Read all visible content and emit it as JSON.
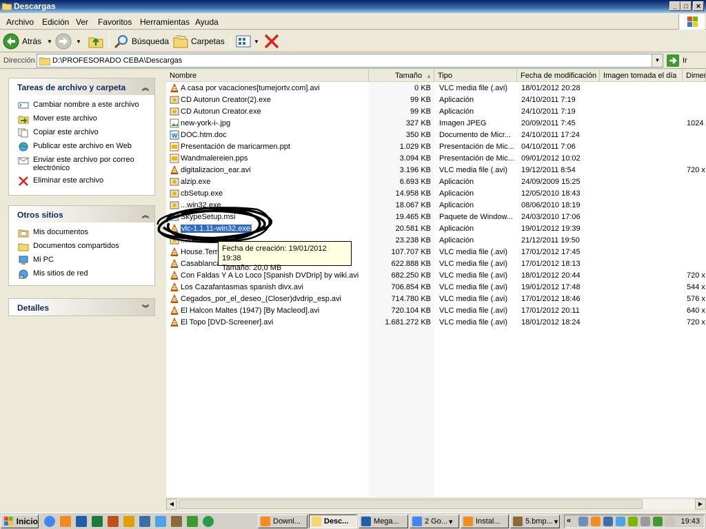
{
  "window": {
    "title": "Descargas"
  },
  "menu": [
    "Archivo",
    "Edición",
    "Ver",
    "Favoritos",
    "Herramientas",
    "Ayuda"
  ],
  "toolbar": {
    "back": "Atrás",
    "search": "Búsqueda",
    "folders": "Carpetas"
  },
  "address": {
    "label": "Dirección",
    "value": "D:\\PROFESORADO CEBA\\Descargas",
    "go": "Ir"
  },
  "tasks_panel": {
    "title": "Tareas de archivo y carpeta",
    "items": [
      {
        "label": "Cambiar nombre a este archivo",
        "icon": "rename-icon"
      },
      {
        "label": "Mover este archivo",
        "icon": "move-icon"
      },
      {
        "label": "Copiar este archivo",
        "icon": "copy-icon"
      },
      {
        "label": "Publicar este archivo en Web",
        "icon": "publish-web-icon"
      },
      {
        "label": "Enviar este archivo por correo electrónico",
        "icon": "email-icon"
      },
      {
        "label": "Eliminar este archivo",
        "icon": "delete-icon"
      }
    ]
  },
  "places_panel": {
    "title": "Otros sitios",
    "items": [
      {
        "label": "Mis documentos",
        "icon": "my-documents-icon"
      },
      {
        "label": "Documentos compartidos",
        "icon": "shared-documents-icon"
      },
      {
        "label": "Mi PC",
        "icon": "my-computer-icon"
      },
      {
        "label": "Mis sitios de red",
        "icon": "network-places-icon"
      }
    ]
  },
  "details_panel": {
    "title": "Detalles"
  },
  "columns": {
    "name": "Nombre",
    "size": "Tamaño",
    "type": "Tipo",
    "modified": "Fecha de modificación",
    "taken": "Imagen tomada el día",
    "dim": "Dimen"
  },
  "files": [
    {
      "name": "A casa por vacaciones[tumejortv.com].avi",
      "size": "0 KB",
      "type": "VLC media file (.avi)",
      "date": "18/01/2012 20:28",
      "dim": "",
      "icon": "vlc"
    },
    {
      "name": "CD Autorun Creator(2).exe",
      "size": "99 KB",
      "type": "Aplicación",
      "date": "24/10/2011 7:19",
      "dim": "",
      "icon": "app"
    },
    {
      "name": "CD Autorun Creator.exe",
      "size": "99 KB",
      "type": "Aplicación",
      "date": "24/10/2011 7:19",
      "dim": "",
      "icon": "app"
    },
    {
      "name": "new-york-i-.jpg",
      "size": "327 KB",
      "type": "Imagen JPEG",
      "date": "20/09/2011 7:45",
      "dim": "1024",
      "icon": "img"
    },
    {
      "name": "DOC.htm.doc",
      "size": "350 KB",
      "type": "Documento de Micr...",
      "date": "24/10/2011 17:24",
      "dim": "",
      "icon": "doc"
    },
    {
      "name": "Presentación de maricarmen.ppt",
      "size": "1.029 KB",
      "type": "Presentación de Mic...",
      "date": "04/10/2011 7:06",
      "dim": "",
      "icon": "ppt"
    },
    {
      "name": "Wandmalereien.pps",
      "size": "3.094 KB",
      "type": "Presentación de Mic...",
      "date": "09/01/2012 10:02",
      "dim": "",
      "icon": "ppt"
    },
    {
      "name": "digitalizacion_ear.avi",
      "size": "3.196 KB",
      "type": "VLC media file (.avi)",
      "date": "19/12/2011 8:54",
      "dim": "720 x",
      "icon": "vlc"
    },
    {
      "name": "alzip.exe",
      "size": "6.693 KB",
      "type": "Aplicación",
      "date": "24/09/2009 15:25",
      "dim": "",
      "icon": "app"
    },
    {
      "name": "cbSetup.exe",
      "size": "14.958 KB",
      "type": "Aplicación",
      "date": "12/05/2010 18:43",
      "dim": "",
      "icon": "app"
    },
    {
      "name": "...win32.exe",
      "size": "18.067 KB",
      "type": "Aplicación",
      "date": "08/06/2010 18:19",
      "dim": "",
      "icon": "app"
    },
    {
      "name": "SkypeSetup.msi",
      "size": "19.465 KB",
      "type": "Paquete de Window...",
      "date": "24/03/2010 17:06",
      "dim": "",
      "icon": "msi"
    },
    {
      "name": "vlc-1.1.11-win32.exe",
      "size": "20.581 KB",
      "type": "Aplicación",
      "date": "19/01/2012 19:39",
      "dim": "",
      "icon": "vlc",
      "selected": true
    },
    {
      "name": "...free.exe",
      "size": "23.238 KB",
      "type": "Aplicación",
      "date": "21/12/2011 19:50",
      "dim": "",
      "icon": "app"
    },
    {
      "name": "House.Tem",
      "size": "107.707 KB",
      "type": "VLC media file (.avi)",
      "date": "17/01/2012 17:45",
      "dim": "",
      "icon": "vlc"
    },
    {
      "name": "Casablanca",
      "size": "622.888 KB",
      "type": "VLC media file (.avi)",
      "date": "17/01/2012 18:13",
      "dim": "",
      "icon": "vlc"
    },
    {
      "name": "Con Faldas Y A Lo Loco [Spanish DVDrip] by wiki.avi",
      "size": "682.250 KB",
      "type": "VLC media file (.avi)",
      "date": "18/01/2012 20:44",
      "dim": "720 x",
      "icon": "vlc"
    },
    {
      "name": "Los Cazafantasmas spanish divx.avi",
      "size": "706.854 KB",
      "type": "VLC media file (.avi)",
      "date": "19/01/2012 17:48",
      "dim": "544 x",
      "icon": "vlc"
    },
    {
      "name": "Cegados_por_el_deseo_(Closer)dvdrip_esp.avi",
      "size": "714.780 KB",
      "type": "VLC media file (.avi)",
      "date": "17/01/2012 18:46",
      "dim": "576 x",
      "icon": "vlc"
    },
    {
      "name": "El Halcon Maltes (1947) [By Macleod].avi",
      "size": "720.104 KB",
      "type": "VLC media file (.avi)",
      "date": "17/01/2012 20:11",
      "dim": "640 x",
      "icon": "vlc"
    },
    {
      "name": "El Topo [DVD-Screener].avi",
      "size": "1.681.272 KB",
      "type": "VLC media file (.avi)",
      "date": "18/01/2012 18:24",
      "dim": "720 x",
      "icon": "vlc"
    }
  ],
  "tooltip": {
    "line1": "Fecha de creación: 19/01/2012 19:38",
    "line2": "Tamaño: 20,0 MB"
  },
  "taskbar": {
    "start": "Inicio",
    "tasks": [
      "Downl...",
      "Desc...",
      "Mega...",
      "2 Go...",
      "Instal...",
      "5.bmp..."
    ],
    "clock": "19:43",
    "tray_chevron": "«"
  },
  "colors": {
    "title_bar": "#0a246a",
    "selection": "#316ac5",
    "vlc_orange": "#f28c1e",
    "panel_header_text": "#0c2a5e"
  }
}
